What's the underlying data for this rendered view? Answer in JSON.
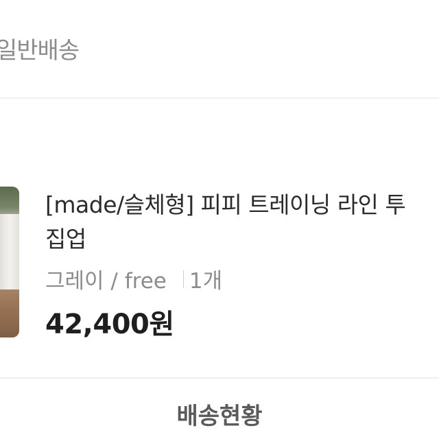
{
  "shipping": {
    "method_label": "일반배송"
  },
  "product": {
    "image_alt": "product-photo",
    "title_line1": "[made/슬체형] 피피 트레이닝 라인 투",
    "title_line2": "집업",
    "option": "그레이 / free",
    "quantity": "1개",
    "price": "42,400원"
  },
  "actions": {
    "tracking_label": "배송현황"
  },
  "colors": {
    "background": "#ffffff",
    "divider": "#efefef",
    "muted_text": "#8c8c8c",
    "primary_text": "#1f1f1f"
  }
}
